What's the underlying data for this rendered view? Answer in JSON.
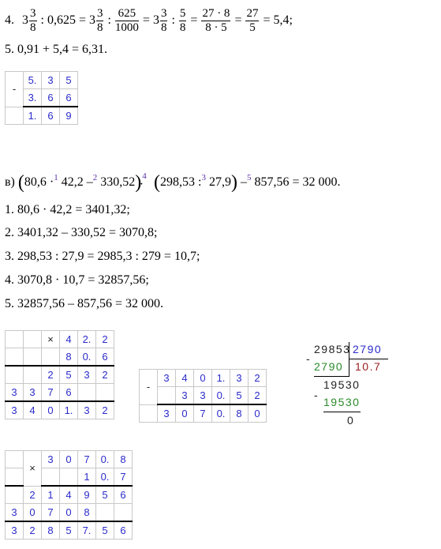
{
  "lines": {
    "l4": {
      "num": "4.",
      "pre": "3",
      "f1n": "3",
      "f1d": "8",
      "t1": ": 0,625 = 3",
      "f2n": "3",
      "f2d": "8",
      "t2": ":",
      "f3n": "625",
      "f3d": "1000",
      "t3": "= 3",
      "f4n": "3",
      "f4d": "8",
      "t4": ":",
      "f5n": "5",
      "f5d": "8",
      "t5": "=",
      "f6n": "27 · 8",
      "f6d": "8 · 5",
      "t6": "=",
      "f7n": "27",
      "f7d": "5",
      "t7": "= 5,4;"
    },
    "l5": "5.  0,91 + 5,4 = 6,31.",
    "v_label": "в)",
    "v_part1": "80,6 ·",
    "v_s1": "1",
    "v_part2": "42,2 –",
    "v_s2": "2",
    "v_part3": "330,52",
    "v_s4": "4",
    "v_part4": "298,53 :",
    "v_s3": "3",
    "v_part5": "27,9",
    "v_part6": "–",
    "v_s5": "5",
    "v_part7": "857,56 = 32 000.",
    "s1": "1.  80,6 · 42,2 = 3401,32;",
    "s2": "2.  3401,32 – 330,52 = 3070,8;",
    "s3": "3.  298,53 : 27,9 = 2985,3 : 279 = 10,7;",
    "s4": "4.  3070,8 · 10,7 = 32857,56;",
    "s5": "5.  32857,56 – 857,56 = 32 000."
  },
  "sub1": {
    "op": "-",
    "r1": [
      "5.",
      "3",
      "5"
    ],
    "r2": [
      "3.",
      "6",
      "6"
    ],
    "r3": [
      "1.",
      "6",
      "9"
    ]
  },
  "mul1": {
    "op": "×",
    "r1": [
      "4",
      "2.",
      "2"
    ],
    "r2": [
      "8",
      "0.",
      "6"
    ],
    "r3": [
      "2",
      "5",
      "3",
      "2"
    ],
    "r4": [
      "3",
      "3",
      "7",
      "6"
    ],
    "r5": [
      "3",
      "4",
      "0",
      "1.",
      "3",
      "2"
    ]
  },
  "sub2": {
    "op": "-",
    "r1": [
      "3",
      "4",
      "0",
      "1.",
      "3",
      "2"
    ],
    "r2": [
      "3",
      "3",
      "0.",
      "5",
      "2"
    ],
    "r3": [
      "3",
      "0",
      "7",
      "0.",
      "8",
      "0"
    ]
  },
  "div": {
    "dividend": "29853",
    "divisor": "2790",
    "sub1": "2790",
    "quot": "10.7",
    "rem1": "19530",
    "sub2": "19530",
    "rem2": "0",
    "minus": "-"
  },
  "mul2": {
    "op": "×",
    "r1": [
      "3",
      "0",
      "7",
      "0.",
      "8"
    ],
    "r2": [
      "1",
      "0.",
      "7"
    ],
    "r3": [
      "2",
      "1",
      "4",
      "9",
      "5",
      "6"
    ],
    "r4": [
      "3",
      "0",
      "7",
      "0",
      "8"
    ],
    "r5": [
      "3",
      "2",
      "8",
      "5",
      "7.",
      "5",
      "6"
    ]
  }
}
